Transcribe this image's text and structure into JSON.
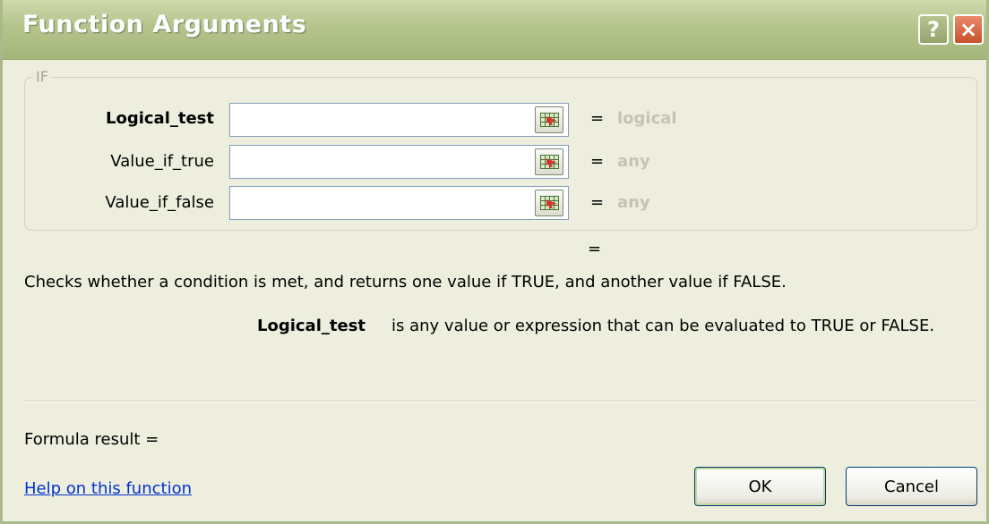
{
  "window": {
    "title": "Function Arguments",
    "help_glyph": "?",
    "close_glyph": "×"
  },
  "function": {
    "name": "IF",
    "arguments": [
      {
        "label": "Logical_test",
        "value": "",
        "equals": "=",
        "type_hint": "logical",
        "bold": true
      },
      {
        "label": "Value_if_true",
        "value": "",
        "equals": "=",
        "type_hint": "any",
        "bold": false
      },
      {
        "label": "Value_if_false",
        "value": "",
        "equals": "=",
        "type_hint": "any",
        "bold": false
      }
    ],
    "result_equals": "="
  },
  "description": "Checks whether a condition is met, and returns one value if TRUE, and another value if FALSE.",
  "argument_help": {
    "name": "Logical_test",
    "text": "is any value or expression that can be evaluated to TRUE or FALSE."
  },
  "footer": {
    "formula_result": "Formula result =",
    "help_link": "Help on this function",
    "ok_label": "OK",
    "cancel_label": "Cancel"
  },
  "icons": {
    "collapse_dialog": "range-select-icon"
  },
  "colors": {
    "titlebar": "#b4c48c",
    "background": "#eeeedf",
    "link": "#0033cc",
    "hint": "#c4c4b4"
  }
}
